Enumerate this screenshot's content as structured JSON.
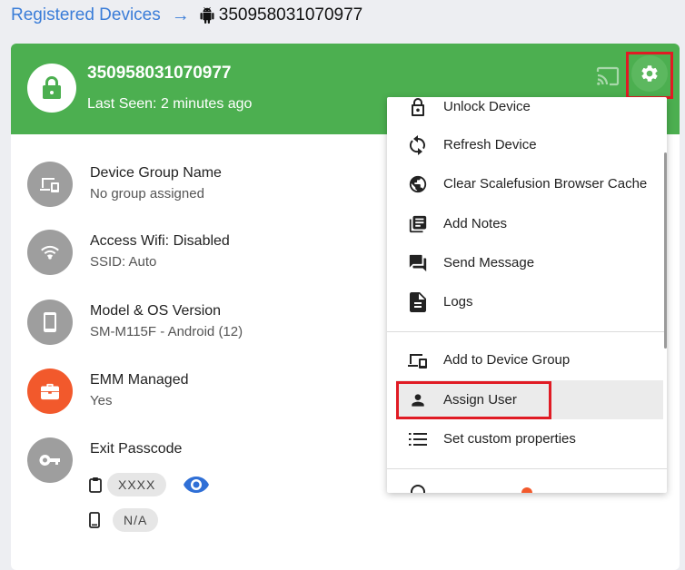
{
  "breadcrumb": {
    "parent": "Registered Devices",
    "arrow": "→",
    "device_id": "350958031070977"
  },
  "header": {
    "device_name": "350958031070977",
    "last_seen": "Last Seen: 2 minutes ago",
    "bg_color": "#4caf50"
  },
  "info": {
    "group_title": "Device Group Name",
    "group_value": "No group assigned",
    "wifi_title": "Access Wifi: Disabled",
    "wifi_value": "SSID: Auto",
    "model_title": "Model & OS Version",
    "model_value": "SM-M115F - Android (12)",
    "emm_title": "EMM Managed",
    "emm_value": "Yes",
    "passcode_title": "Exit Passcode",
    "passcode_masked": "XXXX",
    "passcode_device": "N/A"
  },
  "menu": {
    "items": [
      {
        "label": "Unlock Device",
        "icon": "lock-icon"
      },
      {
        "label": "Refresh Device",
        "icon": "refresh-icon"
      },
      {
        "label": "Clear Scalefusion Browser Cache",
        "icon": "globe-icon"
      },
      {
        "label": "Add Notes",
        "icon": "notes-icon"
      },
      {
        "label": "Send Message",
        "icon": "message-icon"
      },
      {
        "label": "Logs",
        "icon": "document-icon"
      },
      {
        "label": "Add to Device Group",
        "icon": "devices-icon"
      },
      {
        "label": "Assign User",
        "icon": "person-icon"
      },
      {
        "label": "Set custom properties",
        "icon": "list-icon"
      }
    ]
  },
  "colors": {
    "accent_blue": "#3b7dd8",
    "highlight_red": "#e01b24",
    "emm_orange": "#f2592c"
  }
}
